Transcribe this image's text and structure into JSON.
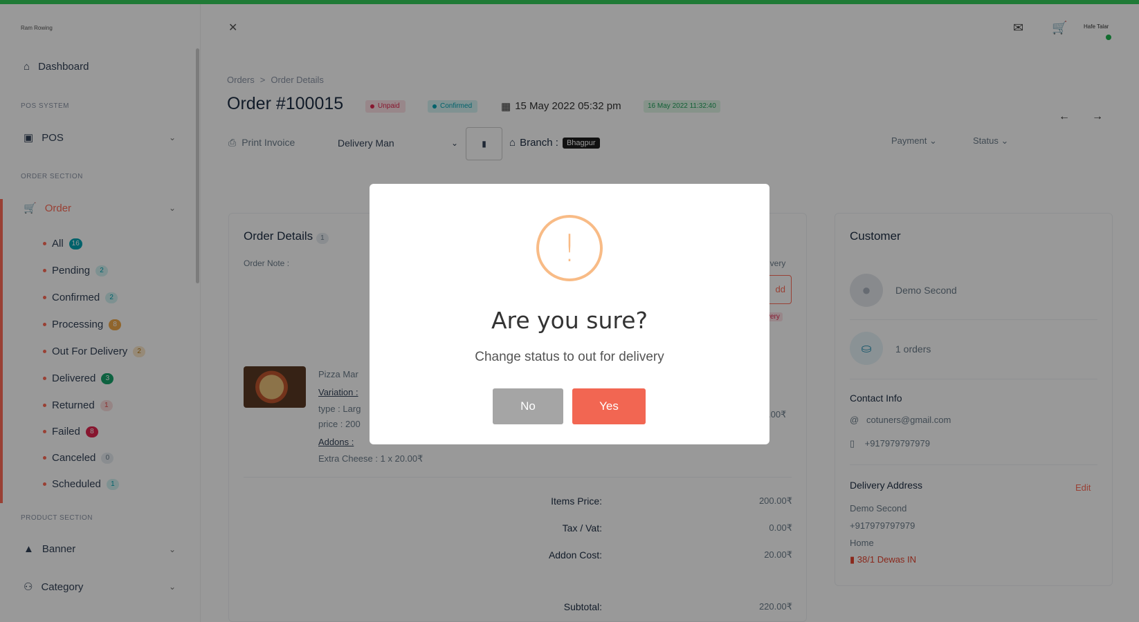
{
  "header": {
    "logo_text": "Ram Rowing",
    "user_name": "Hafe Talar",
    "collapse_icon": "close-icon",
    "icons": [
      "message-icon",
      "cart-icon"
    ]
  },
  "sidebar": {
    "dashboard": "Dashboard",
    "sections": {
      "pos": "POS SYSTEM",
      "order": "ORDER SECTION",
      "product": "PRODUCT SECTION"
    },
    "pos_label": "POS",
    "order_label": "Order",
    "order_items": [
      {
        "label": "All",
        "count": "16"
      },
      {
        "label": "Pending",
        "count": "2"
      },
      {
        "label": "Confirmed",
        "count": "2"
      },
      {
        "label": "Processing",
        "count": "8"
      },
      {
        "label": "Out For Delivery",
        "count": "2"
      },
      {
        "label": "Delivered",
        "count": "3"
      },
      {
        "label": "Returned",
        "count": "1"
      },
      {
        "label": "Failed",
        "count": "8"
      },
      {
        "label": "Canceled",
        "count": "0"
      },
      {
        "label": "Scheduled",
        "count": "1"
      }
    ],
    "banner_label": "Banner",
    "category_label": "Category"
  },
  "main": {
    "breadcrumb": [
      "Orders",
      ">",
      "Order Details"
    ],
    "order_title": "Order #100015",
    "payment_status": "Unpaid",
    "order_status": "Confirmed",
    "order_date": "15 May 2022 05:32 pm",
    "delivery_time": "16 May 2022 11:32:40",
    "print_invoice": "Print Invoice",
    "delivery_man": "Delivery Man",
    "branch_label": "Branch :",
    "branch_name": "Bhagpur",
    "payment_filter": "Payment",
    "status_filter": "Status"
  },
  "order_details": {
    "title": "Order Details",
    "count": "1",
    "note_label": "Order Note :",
    "right_partial_1": "ivery",
    "right_add": "dd",
    "right_partial_2": "very",
    "product": {
      "name": "Pizza Mar",
      "variation_label": "Variation :",
      "type": "type : Larg",
      "price": "price : 200",
      "addons_label": "Addons :",
      "addon_line": "Extra Cheese : 1 x 20.00₹",
      "total": ".00₹"
    },
    "summary": [
      {
        "label": "Items Price:",
        "value": "200.00₹"
      },
      {
        "label": "Tax / Vat:",
        "value": "0.00₹"
      },
      {
        "label": "Addon Cost:",
        "value": "20.00₹"
      },
      {
        "label": "Subtotal:",
        "value": "220.00₹"
      }
    ]
  },
  "customer": {
    "title": "Customer",
    "name": "Demo Second",
    "orders": "1 orders",
    "contact_title": "Contact Info",
    "email": "cotuners@gmail.com",
    "phone": "+917979797979",
    "delivery_title": "Delivery Address",
    "edit": "Edit",
    "addr_name": "Demo Second",
    "addr_phone": "+917979797979",
    "addr_type": "Home",
    "addr_line": "38/1 Dewas IN"
  },
  "modal": {
    "title": "Are you sure?",
    "text": "Change status to out for delivery",
    "no_label": "No",
    "yes_label": "Yes",
    "icon_glyph": "!",
    "icon_name": "warning-icon",
    "colors": {
      "warning": "#f8bb86",
      "yes": "#f26652",
      "no": "#a5a5a5"
    }
  }
}
